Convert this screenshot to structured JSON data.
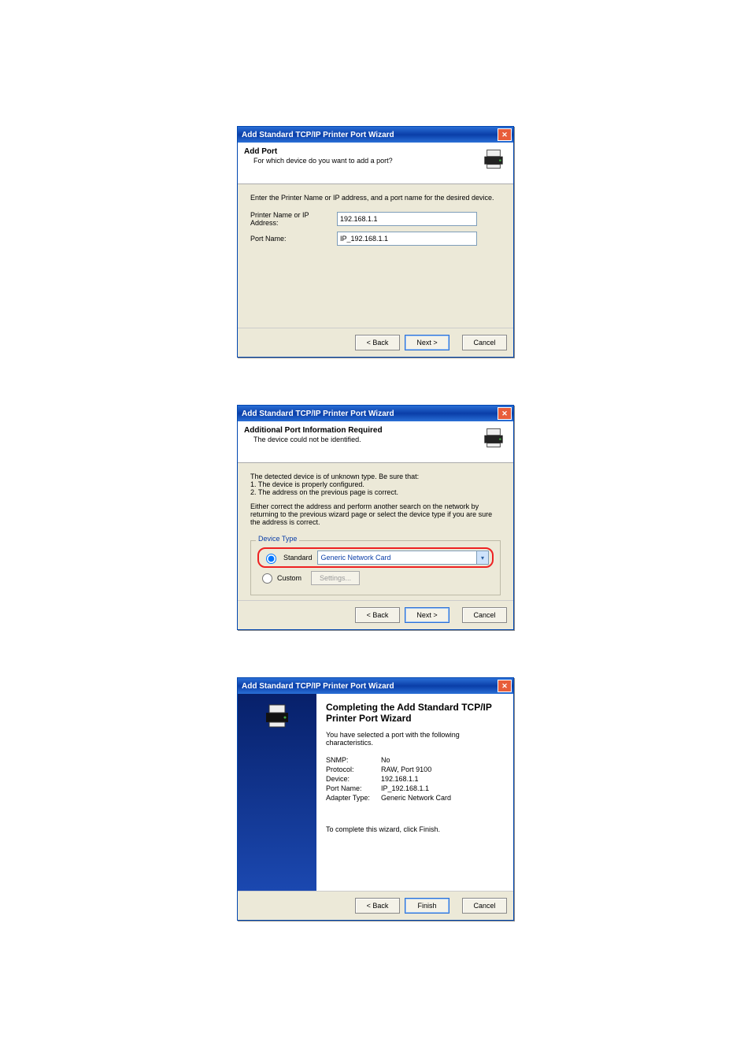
{
  "dialog1": {
    "title": "Add Standard TCP/IP Printer Port Wizard",
    "header_title": "Add Port",
    "header_sub": "For which device do you want to add a port?",
    "instruction": "Enter the Printer Name or IP address, and a port name for the desired device.",
    "label_addr": "Printer Name or IP Address:",
    "label_port": "Port Name:",
    "value_addr": "192.168.1.1",
    "value_port": "IP_192.168.1.1",
    "btn_back": "< Back",
    "btn_next": "Next >",
    "btn_cancel": "Cancel"
  },
  "dialog2": {
    "title": "Add Standard TCP/IP Printer Port Wizard",
    "header_title": "Additional Port Information Required",
    "header_sub": "The device could not be identified.",
    "para1": "The detected device is of unknown type.  Be sure that:",
    "li1": "1. The device is properly configured.",
    "li2": "2. The address on the previous page is correct.",
    "para2": "Either correct the address and perform another search on the network by returning to the previous wizard page or select the device type if you are sure the address is correct.",
    "group_title": "Device Type",
    "radio_standard": "Standard",
    "dropdown_value": "Generic Network Card",
    "radio_custom": "Custom",
    "settings_label": "Settings...",
    "btn_back": "< Back",
    "btn_next": "Next >",
    "btn_cancel": "Cancel"
  },
  "dialog3": {
    "title": "Add Standard TCP/IP Printer Port Wizard",
    "comp_title": "Completing the Add Standard TCP/IP Printer Port Wizard",
    "comp_sub": "You have selected a port with the following characteristics.",
    "kv": {
      "snmp_k": "SNMP:",
      "snmp_v": "No",
      "proto_k": "Protocol:",
      "proto_v": "RAW, Port 9100",
      "dev_k": "Device:",
      "dev_v": "192.168.1.1",
      "port_k": "Port Name:",
      "port_v": "IP_192.168.1.1",
      "adapter_k": "Adapter Type:",
      "adapter_v": "Generic Network Card"
    },
    "foot": "To complete this wizard, click Finish.",
    "btn_back": "< Back",
    "btn_finish": "Finish",
    "btn_cancel": "Cancel"
  }
}
